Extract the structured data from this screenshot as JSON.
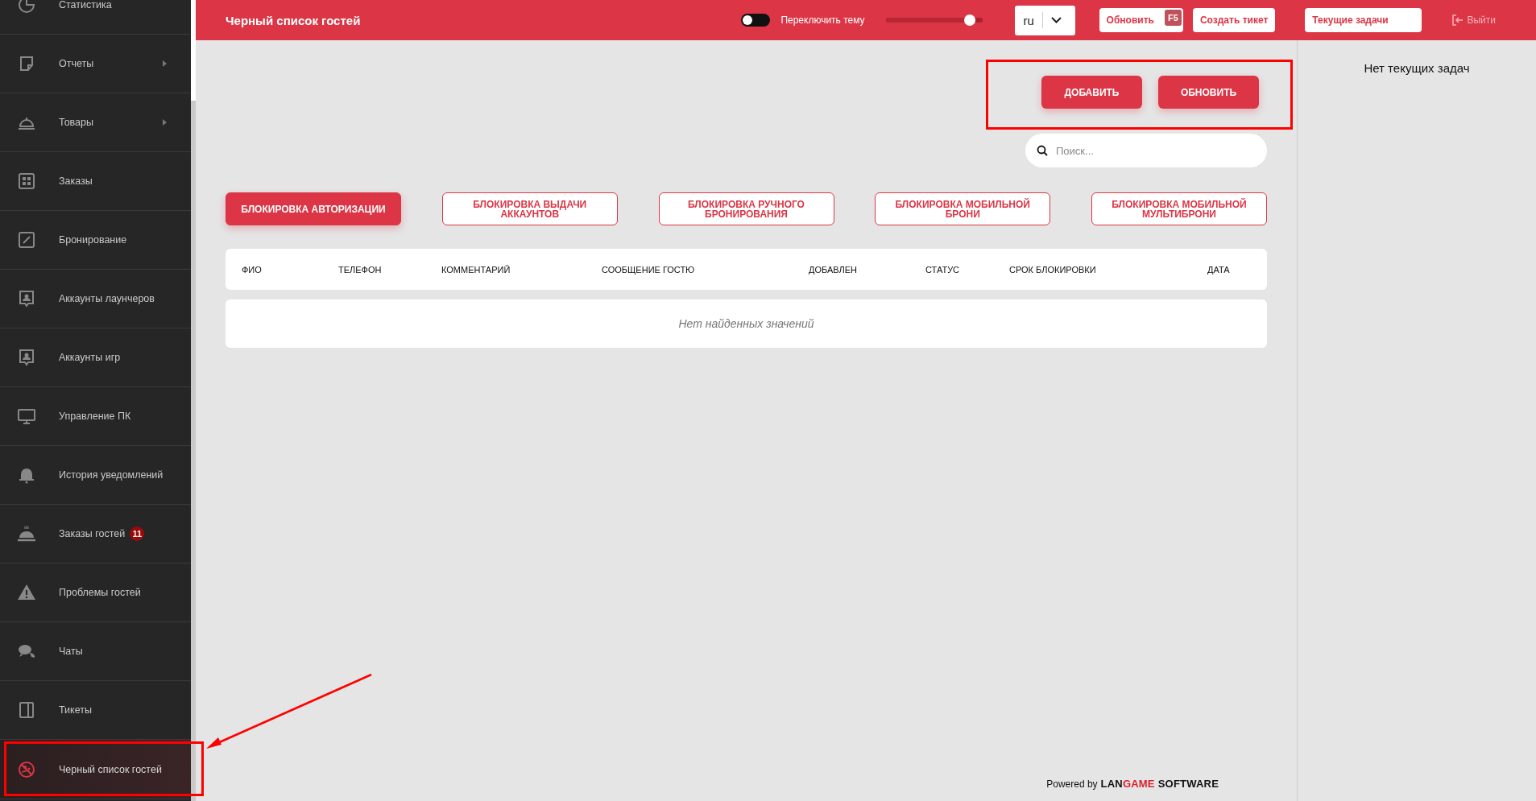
{
  "sidebar": {
    "items": [
      {
        "label": "Статистика",
        "expandable": false,
        "selected": false
      },
      {
        "label": "Отчеты",
        "expandable": true,
        "selected": false
      },
      {
        "label": "Товары",
        "expandable": true,
        "selected": false
      },
      {
        "label": "Заказы",
        "expandable": false,
        "selected": false
      },
      {
        "label": "Бронирование",
        "expandable": false,
        "selected": false
      },
      {
        "label": "Аккаунты лаунчеров",
        "expandable": false,
        "selected": false
      },
      {
        "label": "Аккаунты игр",
        "expandable": false,
        "selected": false
      },
      {
        "label": "Управление ПК",
        "expandable": false,
        "selected": false
      },
      {
        "label": "История уведомлений",
        "expandable": false,
        "selected": false
      },
      {
        "label": "Заказы гостей",
        "expandable": false,
        "selected": false,
        "badge": "11"
      },
      {
        "label": "Проблемы гостей",
        "expandable": false,
        "selected": false
      },
      {
        "label": "Чаты",
        "expandable": false,
        "selected": false
      },
      {
        "label": "Тикеты",
        "expandable": false,
        "selected": false
      },
      {
        "label": "Черный список гостей",
        "expandable": false,
        "selected": true
      }
    ]
  },
  "topbar": {
    "title": "Черный список гостей",
    "theme_toggle": {
      "label": "Переключить тему",
      "on": false
    },
    "slider": {
      "level": 0.93
    },
    "language": {
      "value": "ru"
    },
    "buttons": [
      {
        "kind": "button",
        "label": "Обновить",
        "shortcut": "F5"
      },
      {
        "kind": "button",
        "label": "Создать тикет"
      },
      {
        "kind": "wide",
        "label": "Текущие задачи"
      },
      {
        "kind": "logout",
        "label": "Выйти"
      }
    ]
  },
  "actions": [
    "ДОБАВИТЬ",
    "ОБНОВИТЬ"
  ],
  "search": {
    "placeholder": "Поиск..."
  },
  "tabs": [
    {
      "label": "БЛОКИРОВКА АВТОРИЗАЦИИ",
      "selected": true
    },
    {
      "label": "БЛОКИРОВКА ВЫДАЧИ АККАУНТОВ",
      "selected": false
    },
    {
      "label": "БЛОКИРОВКА РУЧНОГО БРОНИРОВАНИЯ",
      "selected": false
    },
    {
      "label": "БЛОКИРОВКА МОБИЛЬНОЙ БРОНИ",
      "selected": false
    },
    {
      "label": "БЛОКИРОВКА МОБИЛЬНОЙ МУЛЬТИБРОНИ",
      "selected": false
    }
  ],
  "table": {
    "columns": [
      "ФИО",
      "ТЕЛЕФОН",
      "КОММЕНТАРИЙ",
      "СООБЩЕНИЕ ГОСТЮ",
      "ДОБАВЛЕН",
      "СТАТУС",
      "СРОК БЛОКИРОВКИ",
      "ДАТА"
    ],
    "empty_text": "Нет найденных значений"
  },
  "footer": {
    "prefix": "Powered by",
    "brand_part_1": "LAN",
    "brand_part_2": "GAME",
    "brand_part_3": "SOFTWARE"
  },
  "tasks_panel": {
    "empty_text": "Нет текущих задач"
  },
  "annotations": [
    {
      "kind": "box"
    },
    {
      "kind": "box"
    },
    {
      "kind": "arrow"
    }
  ]
}
